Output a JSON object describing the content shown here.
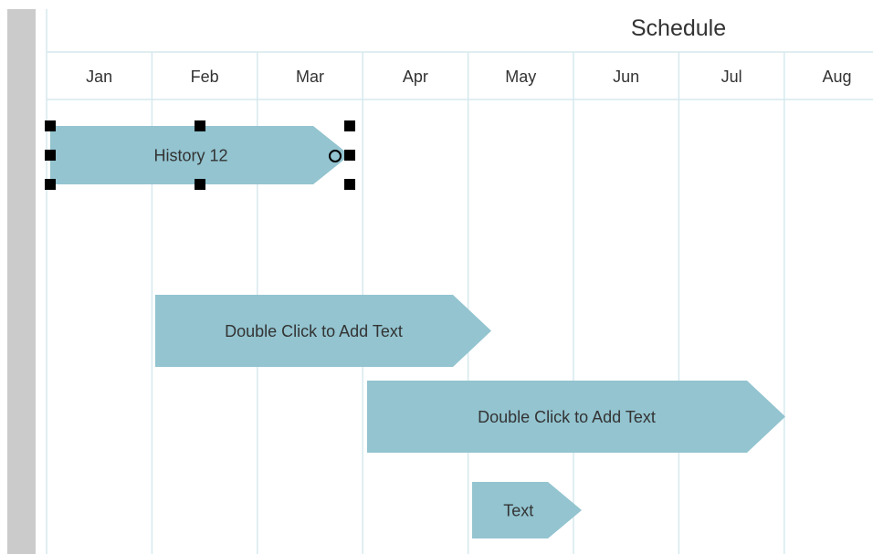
{
  "title": "Schedule",
  "months": [
    "Jan",
    "Feb",
    "Mar",
    "Apr",
    "May",
    "Jun",
    "Jul",
    "Aug"
  ],
  "colors": {
    "bar_fill": "#93c4d0",
    "grid_line": "#d6e9ee",
    "gutter": "#cbcbcb",
    "text": "#333333",
    "handle": "#000000"
  },
  "tasks": [
    {
      "label": "History 12",
      "start_month": "Jan",
      "end_month": "Mar",
      "selected": true
    },
    {
      "label": "Double Click to Add Text",
      "start_month": "Feb",
      "end_month": "May",
      "selected": false
    },
    {
      "label": "Double Click to Add Text",
      "start_month": "Apr",
      "end_month": "Jul",
      "selected": false
    },
    {
      "label": "Text",
      "start_month": "May",
      "end_month": "Jun",
      "selected": false
    }
  ]
}
